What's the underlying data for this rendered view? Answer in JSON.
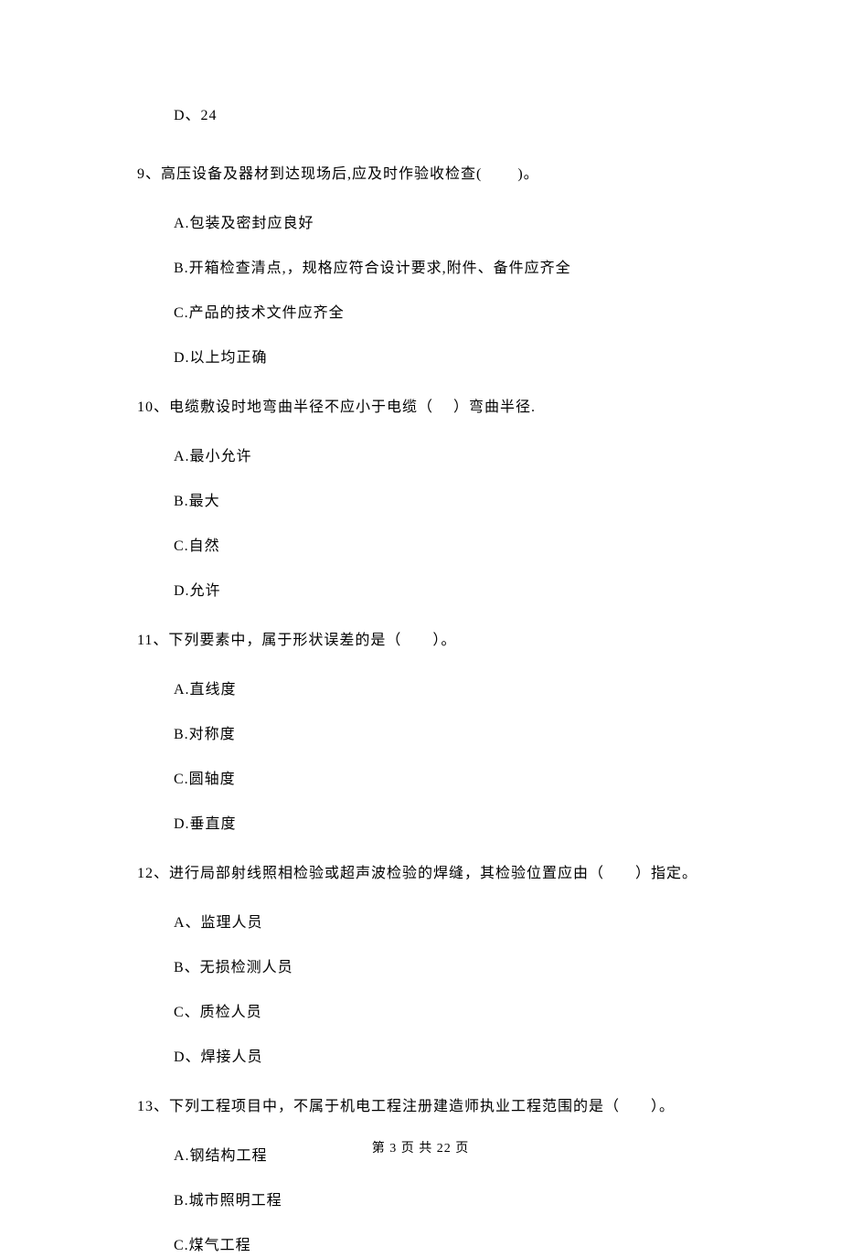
{
  "orphan_option": "D、24",
  "questions": [
    {
      "number": "9、",
      "stem": "高压设备及器材到达现场后,应及时作验收检查(　　 )。",
      "options": [
        "A.包装及密封应良好",
        "B.开箱检查清点,，规格应符合设计要求,附件、备件应齐全",
        "C.产品的技术文件应齐全",
        "D.以上均正确"
      ]
    },
    {
      "number": "10、",
      "stem": "电缆敷设时地弯曲半径不应小于电缆（　 ）弯曲半径.",
      "options": [
        "A.最小允许",
        "B.最大",
        "C.自然",
        "D.允许"
      ]
    },
    {
      "number": "11、",
      "stem": "下列要素中，属于形状误差的是（　　）。",
      "options": [
        "A.直线度",
        "B.对称度",
        "C.圆轴度",
        "D.垂直度"
      ]
    },
    {
      "number": "12、",
      "stem": "进行局部射线照相检验或超声波检验的焊缝，其检验位置应由（　　）指定。",
      "options": [
        "A、监理人员",
        "B、无损检测人员",
        "C、质检人员",
        "D、焊接人员"
      ]
    },
    {
      "number": "13、",
      "stem": "下列工程项目中，不属于机电工程注册建造师执业工程范围的是（　　）。",
      "options": [
        "A.钢结构工程",
        "B.城市照明工程",
        "C.煤气工程"
      ]
    }
  ],
  "footer": "第 3 页 共 22 页"
}
